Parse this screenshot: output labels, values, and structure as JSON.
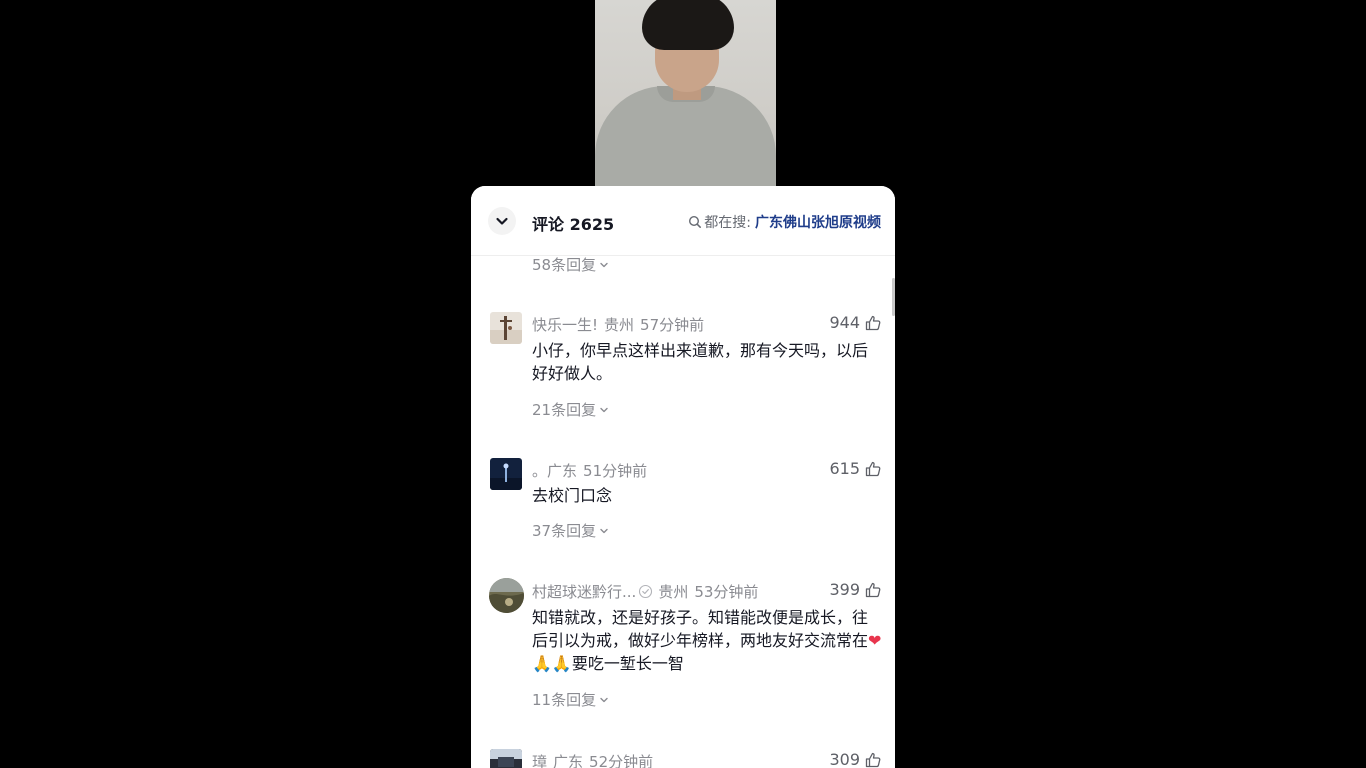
{
  "header": {
    "title": "评论 2625",
    "search_prefix": "都在搜:",
    "search_term": "广东佛山张旭原视频"
  },
  "top_replies": "58条回复",
  "comments": [
    {
      "user": "快乐一生!",
      "location": "贵州",
      "time": "57分钟前",
      "likes": "944",
      "text": "小仔，你早点这样出来道歉，那有今天吗，以后好好做人。",
      "replies": "21条回复"
    },
    {
      "user": "。",
      "location": "广东",
      "time": "51分钟前",
      "likes": "615",
      "text": "去校门口念",
      "replies": "37条回复"
    },
    {
      "user": "村超球迷黔行...",
      "location": "贵州",
      "time": "53分钟前",
      "likes": "399",
      "text": "知错就改，还是好孩子。知错能改便是成长，往后引以为戒，做好少年榜样，两地友好交流常在",
      "text_tail": "要吃一堑长一智",
      "emojis": [
        "heart",
        "pray",
        "pray"
      ],
      "replies": "11条回复"
    },
    {
      "user": "璋",
      "location": "广东",
      "time": "52分钟前",
      "likes": "309"
    }
  ]
}
